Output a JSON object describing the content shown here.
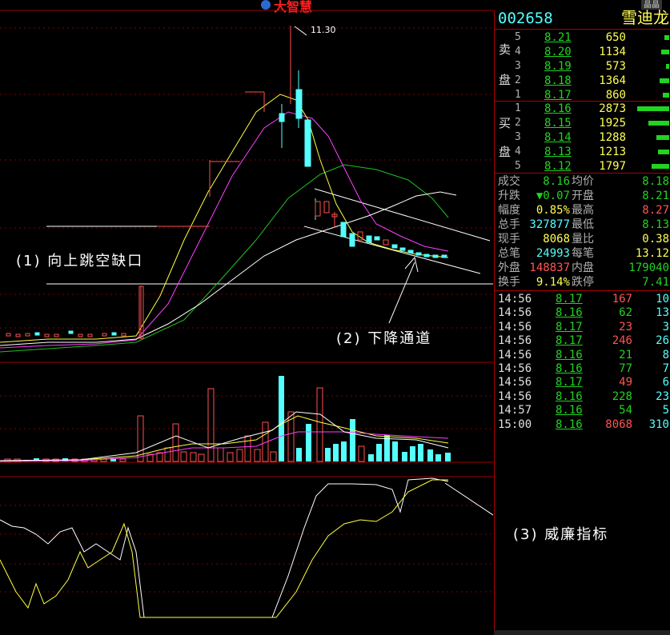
{
  "app": {
    "brand": "大智慧",
    "top_tab": "晶晶"
  },
  "annotations": {
    "gap": "(1) 向上跳空缺口",
    "channel": "(2) 下降通道",
    "williams": "(3) 威廉指标",
    "high_price": "11.30"
  },
  "stock": {
    "code": "002658",
    "name": "雪迪龙"
  },
  "sell_side": {
    "label_top": "卖",
    "label_bottom": "盘",
    "levels": [
      {
        "n": "5",
        "price": "8.21",
        "vol": "650"
      },
      {
        "n": "4",
        "price": "8.20",
        "vol": "1134"
      },
      {
        "n": "3",
        "price": "8.19",
        "vol": "573"
      },
      {
        "n": "2",
        "price": "8.18",
        "vol": "1364"
      },
      {
        "n": "1",
        "price": "8.17",
        "vol": "860"
      }
    ]
  },
  "buy_side": {
    "label_top": "买",
    "label_bottom": "盘",
    "levels": [
      {
        "n": "1",
        "price": "8.16",
        "vol": "2873"
      },
      {
        "n": "2",
        "price": "8.15",
        "vol": "1925"
      },
      {
        "n": "3",
        "price": "8.14",
        "vol": "1288"
      },
      {
        "n": "4",
        "price": "8.13",
        "vol": "1213"
      },
      {
        "n": "5",
        "price": "8.12",
        "vol": "1797"
      }
    ]
  },
  "quote": {
    "l1": "成交",
    "v1": "8.16",
    "l2": "均价",
    "v2": "8.18",
    "l3": "升跌",
    "v3": "▼0.07",
    "l4": "开盘",
    "v4": "8.21",
    "l5": "幅度",
    "v5": "0.85%",
    "l6": "最高",
    "v6": "8.27",
    "l7": "总手",
    "v7": "327877",
    "l8": "最低",
    "v8": "8.13",
    "l9": "现手",
    "v9": "8068",
    "l10": "量比",
    "v10": "0.38",
    "l11": "总笔",
    "v11": "24993",
    "l12": "每笔",
    "v12": "13.12",
    "l13": "外盘",
    "v13": "148837",
    "l14": "内盘",
    "v14": "179040",
    "l15": "换手",
    "v15": "9.14%",
    "l16": "跌停",
    "v16": "7.41"
  },
  "ticks": [
    {
      "t": "14:56",
      "p": "8.17",
      "v": "167",
      "n": "10",
      "pc": "g",
      "vc": "r"
    },
    {
      "t": "14:56",
      "p": "8.16",
      "v": "62",
      "n": "13",
      "pc": "g",
      "vc": "g"
    },
    {
      "t": "14:56",
      "p": "8.17",
      "v": "23",
      "n": "3",
      "pc": "g",
      "vc": "r"
    },
    {
      "t": "14:56",
      "p": "8.17",
      "v": "246",
      "n": "26",
      "pc": "g",
      "vc": "r"
    },
    {
      "t": "14:56",
      "p": "8.16",
      "v": "21",
      "n": "8",
      "pc": "g",
      "vc": "g"
    },
    {
      "t": "14:56",
      "p": "8.16",
      "v": "77",
      "n": "7",
      "pc": "g",
      "vc": "g"
    },
    {
      "t": "14:56",
      "p": "8.17",
      "v": "49",
      "n": "6",
      "pc": "g",
      "vc": "r"
    },
    {
      "t": "14:56",
      "p": "8.16",
      "v": "228",
      "n": "23",
      "pc": "g",
      "vc": "g"
    },
    {
      "t": "14:57",
      "p": "8.16",
      "v": "54",
      "n": "5",
      "pc": "g",
      "vc": "g"
    },
    {
      "t": "15:00",
      "p": "8.16",
      "v": "8068",
      "n": "310",
      "pc": "g",
      "vc": "r"
    }
  ],
  "colors": {
    "up": "#ff5050",
    "down": "#55ffff",
    "ma5": "#ffffff",
    "ma10": "#ffff40",
    "ma20": "#ff40ff",
    "ma60": "#20c020",
    "grid": "#a00000"
  }
}
